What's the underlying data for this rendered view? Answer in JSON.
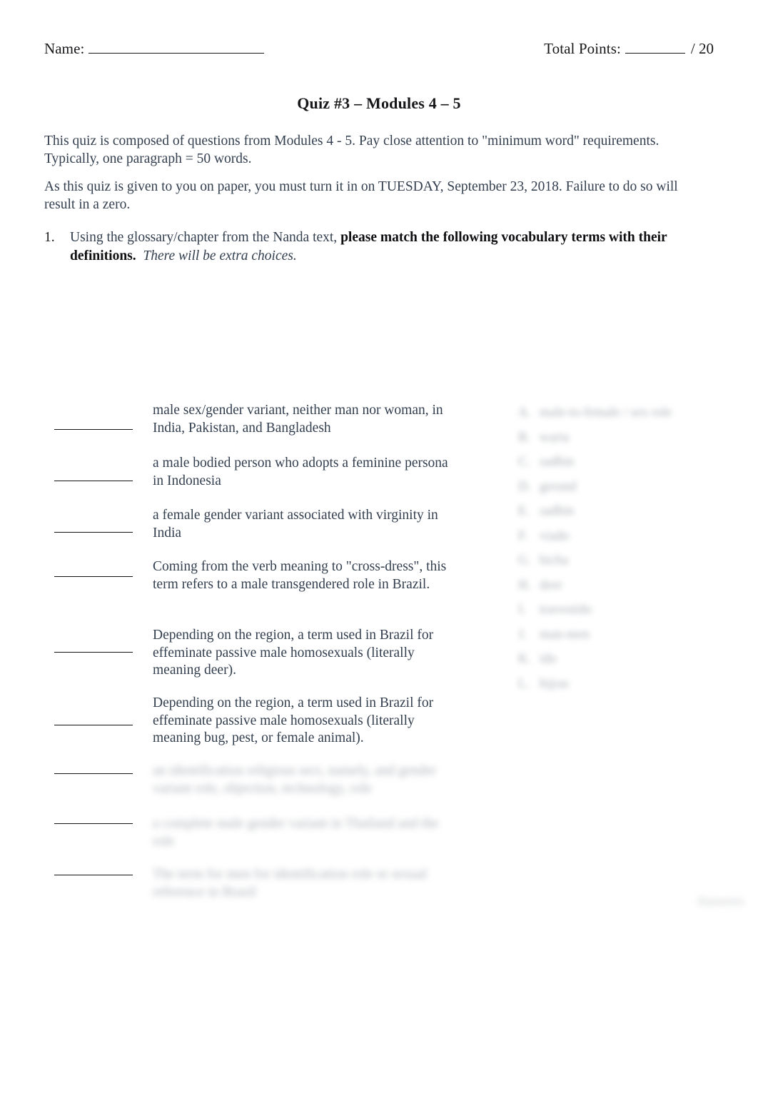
{
  "header": {
    "name_label": "Name:",
    "total_points_label": "Total Points:",
    "points_suffix": "/ 20"
  },
  "title": "Quiz #3 – Modules 4 – 5",
  "intro": {
    "paragraph_1": "This quiz is composed of questions from Modules 4 - 5. Pay close attention to \"minimum word\" requirements. Typically, one paragraph = 50 words.",
    "paragraph_2": "As this quiz is given to you on paper, you must turn it in on TUESDAY, September 23, 2018.  Failure to do so will result in a zero."
  },
  "question_1": {
    "number": "1.",
    "text_plain": "Using the glossary/chapter from the Nanda text, ",
    "text_bold": "please match the following vocabulary terms with their definitions.",
    "text_italic": "There will be extra choices."
  },
  "matching": {
    "blank_count": 9,
    "definitions": [
      {
        "id": "def-1",
        "text": "male sex/gender variant, neither man nor woman, in India, Pakistan, and Bangladesh",
        "redacted": false
      },
      {
        "id": "def-2",
        "text": "a male bodied person who adopts a feminine persona in Indonesia",
        "redacted": false
      },
      {
        "id": "def-3",
        "text": "a female gender variant associated with virginity in India",
        "redacted": false
      },
      {
        "id": "def-4",
        "text": "Coming from the verb meaning to \"cross-dress\", this term refers to a male transgendered role in Brazil.",
        "redacted": false
      },
      {
        "id": "def-5",
        "text": "Depending on the region, a term used in Brazil for effeminate passive male homosexuals (literally meaning deer).",
        "redacted": false
      },
      {
        "id": "def-6",
        "text": "Depending on the region, a term used in Brazil for effeminate passive male homosexuals (literally meaning bug, pest, or female animal).",
        "redacted": false
      },
      {
        "id": "def-7",
        "text": "an identification religious sect, namely, and gender variant role, objection, technology, role",
        "redacted": true
      },
      {
        "id": "def-8",
        "text": "a complete male gender variant in Thailand and the role",
        "redacted": true
      },
      {
        "id": "def-9",
        "text": "The term for men for identification role or sexual reference in Brazil",
        "redacted": true
      }
    ],
    "choices": [
      {
        "letter": "A.",
        "text": "male-to-female / sex role",
        "redacted": true
      },
      {
        "letter": "B.",
        "text": "waria",
        "redacted": true
      },
      {
        "letter": "C.",
        "text": "sadhin",
        "redacted": true
      },
      {
        "letter": "D.",
        "text": "gerund",
        "redacted": true
      },
      {
        "letter": "E.",
        "text": "sadhin",
        "redacted": true
      },
      {
        "letter": "F.",
        "text": "viado",
        "redacted": true
      },
      {
        "letter": "G.",
        "text": "bicha",
        "redacted": true
      },
      {
        "letter": "H.",
        "text": "deer",
        "redacted": true
      },
      {
        "letter": "I.",
        "text": "travestido",
        "redacted": true
      },
      {
        "letter": "J.",
        "text": "man-men",
        "redacted": true
      },
      {
        "letter": "K.",
        "text": "ido",
        "redacted": true
      },
      {
        "letter": "L.",
        "text": "hijras",
        "redacted": true
      }
    ]
  },
  "watermark": "Answers"
}
